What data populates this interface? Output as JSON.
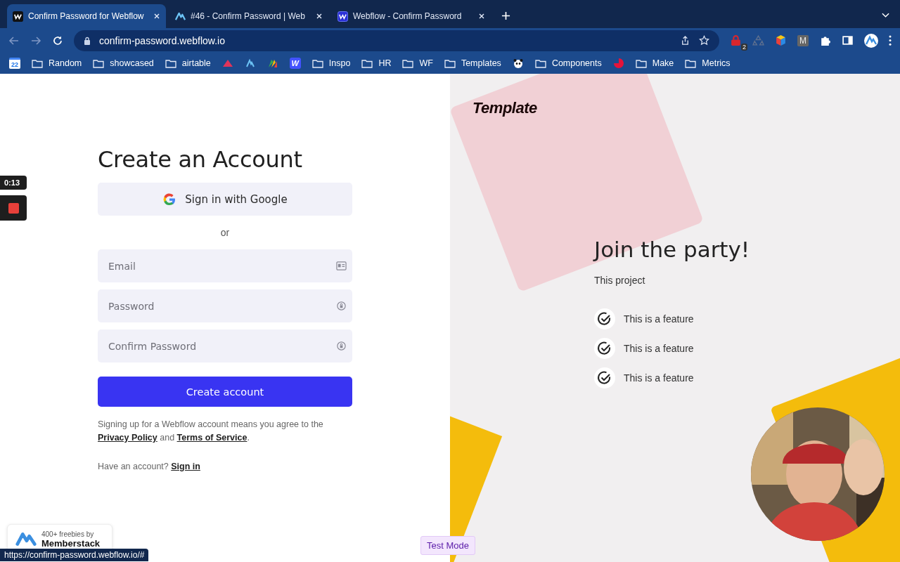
{
  "browser": {
    "tabs": [
      {
        "title": "Confirm Password for Webflow",
        "selected": true
      },
      {
        "title": "#46 - Confirm Password | Web",
        "selected": false
      },
      {
        "title": "Webflow - Confirm Password",
        "selected": false
      }
    ],
    "address": "confirm-password.webflow.io",
    "extensions": [
      {
        "kind": "lock",
        "badge": "2"
      },
      {
        "kind": "recycle"
      },
      {
        "kind": "cube"
      },
      {
        "kind": "letter",
        "label": "M"
      },
      {
        "kind": "puzzle"
      },
      {
        "kind": "sidebar"
      },
      {
        "kind": "avatar"
      }
    ],
    "bookmarks": [
      {
        "kind": "calendar",
        "label": "22"
      },
      {
        "kind": "folder",
        "label": "Random"
      },
      {
        "kind": "folder",
        "label": "showcased"
      },
      {
        "kind": "folder",
        "label": "airtable"
      },
      {
        "kind": "triangle"
      },
      {
        "kind": "logo-a"
      },
      {
        "kind": "tricolor"
      },
      {
        "kind": "w-logo",
        "label": "W"
      },
      {
        "kind": "folder",
        "label": "Inspo"
      },
      {
        "kind": "folder",
        "label": "HR"
      },
      {
        "kind": "folder",
        "label": "WF"
      },
      {
        "kind": "folder",
        "label": "Templates"
      },
      {
        "kind": "panda"
      },
      {
        "kind": "folder",
        "label": "Components"
      },
      {
        "kind": "pie"
      },
      {
        "kind": "folder",
        "label": "Make"
      },
      {
        "kind": "folder",
        "label": "Metrics"
      }
    ]
  },
  "recorder": {
    "time": "0:13"
  },
  "signup": {
    "title": "Create an Account",
    "google_button": "Sign in with Google",
    "divider": "or",
    "fields": [
      {
        "placeholder": "Email"
      },
      {
        "placeholder": "Password"
      },
      {
        "placeholder": "Confirm Password"
      }
    ],
    "submit": "Create account",
    "terms": {
      "text": "Signing up for a Webflow account means you agree to the",
      "privacy_link": "Privacy Policy",
      "joiner": "and",
      "terms_link": "Terms of Service",
      "end": "."
    },
    "signin": {
      "text": "Have an account?",
      "link": "Sign in"
    }
  },
  "promo": {
    "logo": "Template",
    "title": "Join the party!",
    "subtitle": "This project",
    "features": [
      "This is a feature",
      "This is a feature",
      "This is a feature"
    ]
  },
  "memberstack_badge": {
    "tagline": "400+ freebies by",
    "brand": "Memberstack"
  },
  "status_url": "https://confirm-password.webflow.io/#",
  "test_mode": "Test Mode"
}
